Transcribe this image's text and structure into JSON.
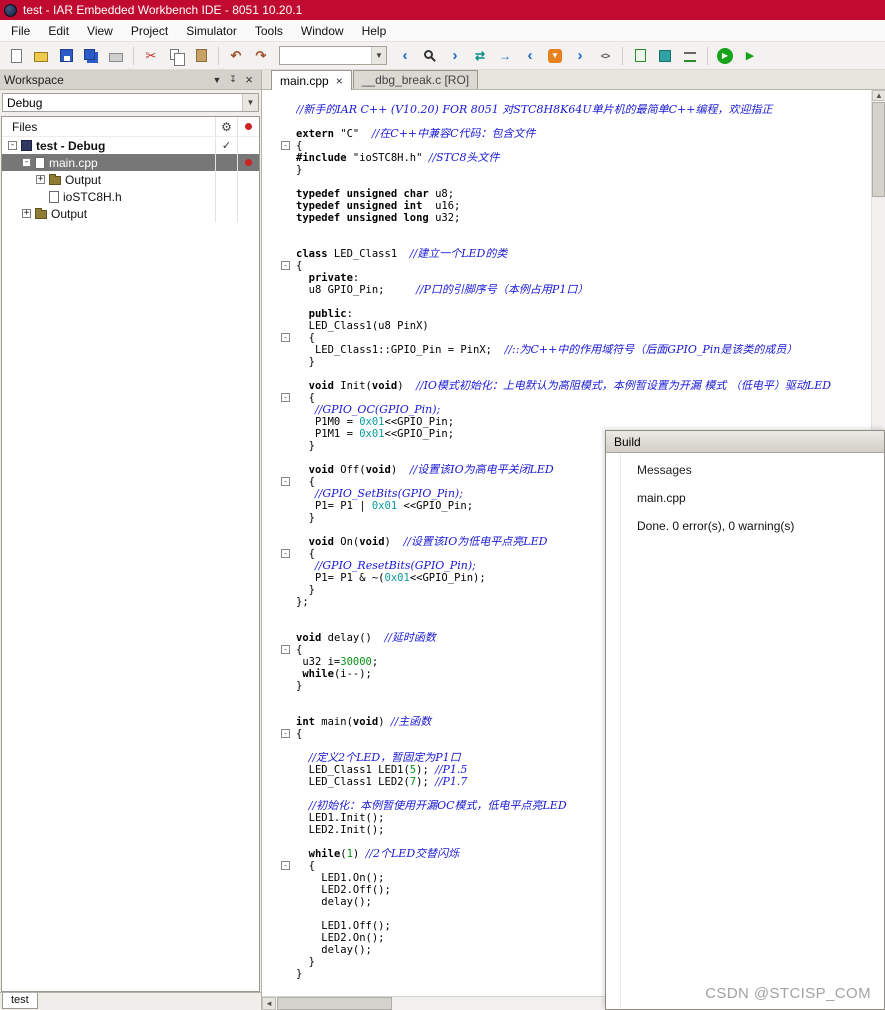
{
  "window": {
    "title": "test - IAR Embedded Workbench IDE - 8051 10.20.1"
  },
  "menu": [
    "File",
    "Edit",
    "View",
    "Project",
    "Simulator",
    "Tools",
    "Window",
    "Help"
  ],
  "toolbar": {
    "find_value": "",
    "buttons": [
      {
        "name": "new-document-icon",
        "kind": "page"
      },
      {
        "name": "open-file-icon",
        "kind": "open"
      },
      {
        "name": "save-icon",
        "kind": "save"
      },
      {
        "name": "save-all-icon",
        "kind": "saveall"
      },
      {
        "name": "print-icon",
        "kind": "print"
      },
      {
        "name": "toolbar-separator",
        "kind": "sep"
      },
      {
        "name": "cut-icon",
        "kind": "cut"
      },
      {
        "name": "copy-icon",
        "kind": "copy"
      },
      {
        "name": "paste-icon",
        "kind": "paste"
      },
      {
        "name": "toolbar-separator",
        "kind": "sep"
      },
      {
        "name": "undo-icon",
        "kind": "undo"
      },
      {
        "name": "redo-icon",
        "kind": "redo"
      },
      {
        "name": "find-combo",
        "kind": "combo"
      },
      {
        "name": "find-previous-icon",
        "kind": "prev"
      },
      {
        "name": "search-icon",
        "kind": "search"
      },
      {
        "name": "find-next-icon",
        "kind": "next"
      },
      {
        "name": "replace-icon",
        "kind": "swap"
      },
      {
        "name": "goto-icon",
        "kind": "goto"
      },
      {
        "name": "nav-back-icon",
        "kind": "prev"
      },
      {
        "name": "download-icon",
        "kind": "shield"
      },
      {
        "name": "nav-forward-icon",
        "kind": "next"
      },
      {
        "name": "toggle-header-source-icon",
        "kind": "hdr"
      },
      {
        "name": "toolbar-separator",
        "kind": "sep"
      },
      {
        "name": "compile-icon",
        "kind": "cdoc"
      },
      {
        "name": "make-icon",
        "kind": "cube"
      },
      {
        "name": "batch-build-icon",
        "kind": "listadd"
      },
      {
        "name": "toolbar-separator",
        "kind": "sep"
      },
      {
        "name": "download-and-debug-icon",
        "kind": "playbig"
      },
      {
        "name": "debug-without-downloading-icon",
        "kind": "play"
      }
    ]
  },
  "workspace": {
    "panel_title": "Workspace",
    "config_selector": "Debug",
    "files_header": "Files",
    "bottom_tab": "test",
    "tree": [
      {
        "label": "test - Debug",
        "level": 0,
        "expand": "-",
        "icon": "project",
        "bold": true,
        "col1": "check",
        "col2": ""
      },
      {
        "label": "main.cpp",
        "level": 1,
        "expand": "-",
        "icon": "file",
        "selected": true,
        "col1": "",
        "col2": "dot"
      },
      {
        "label": "Output",
        "level": 2,
        "expand": "+",
        "icon": "folder",
        "col1": "",
        "col2": ""
      },
      {
        "label": "ioSTC8H.h",
        "level": 2,
        "expand": "",
        "icon": "file",
        "col1": "",
        "col2": ""
      },
      {
        "label": "Output",
        "level": 1,
        "expand": "+",
        "icon": "folder",
        "col1": "",
        "col2": ""
      }
    ]
  },
  "editor": {
    "tabs": [
      {
        "label": "main.cpp",
        "active": true,
        "closable": true
      },
      {
        "label": "__dbg_break.c [RO]",
        "active": false,
        "closable": false
      }
    ],
    "lines": [
      {
        "s": [
          [
            "c",
            "//新手的IAR C++ (V10.20) FOR 8051 对STC8H8K64U单片机的最简单C++编程，欢迎指正"
          ]
        ]
      },
      {
        "s": []
      },
      {
        "s": [
          [
            "k",
            "extern"
          ],
          [
            "p",
            " \"C\"  "
          ],
          [
            "c",
            "//在C++中兼容C代码：包含文件"
          ]
        ]
      },
      {
        "m": 1,
        "s": [
          [
            "p",
            "{"
          ]
        ]
      },
      {
        "s": [
          [
            "k",
            "#include"
          ],
          [
            "p",
            " \"ioSTC8H.h\" "
          ],
          [
            "c",
            "//STC8头文件"
          ]
        ]
      },
      {
        "s": [
          [
            "p",
            "}"
          ]
        ]
      },
      {
        "s": []
      },
      {
        "s": [
          [
            "k",
            "typedef unsigned char"
          ],
          [
            "p",
            " u8;"
          ]
        ]
      },
      {
        "s": [
          [
            "k",
            "typedef unsigned int"
          ],
          [
            "p",
            "  u16;"
          ]
        ]
      },
      {
        "s": [
          [
            "k",
            "typedef unsigned long"
          ],
          [
            "p",
            " u32;"
          ]
        ]
      },
      {
        "s": []
      },
      {
        "s": []
      },
      {
        "s": [
          [
            "k",
            "class"
          ],
          [
            "p",
            " LED_Class1  "
          ],
          [
            "c",
            "//建立一个LED的类"
          ]
        ]
      },
      {
        "m": 1,
        "s": [
          [
            "p",
            "{"
          ]
        ]
      },
      {
        "s": [
          [
            "p",
            "  "
          ],
          [
            "k",
            "private"
          ],
          [
            "p",
            ":"
          ]
        ]
      },
      {
        "s": [
          [
            "p",
            "  u8 GPIO_Pin;     "
          ],
          [
            "c",
            "//P口的引脚序号（本例占用P1口）"
          ]
        ]
      },
      {
        "s": []
      },
      {
        "s": [
          [
            "p",
            "  "
          ],
          [
            "k",
            "public"
          ],
          [
            "p",
            ":"
          ]
        ]
      },
      {
        "s": [
          [
            "p",
            "  LED_Class1(u8 PinX)"
          ]
        ]
      },
      {
        "m": 1,
        "s": [
          [
            "p",
            "  {"
          ]
        ]
      },
      {
        "s": [
          [
            "p",
            "   LED_Class1::GPIO_Pin = PinX;  "
          ],
          [
            "c",
            "//::为C++中的作用域符号（后面GPIO_Pin是该类的成员）"
          ]
        ]
      },
      {
        "s": [
          [
            "p",
            "  }"
          ]
        ]
      },
      {
        "s": []
      },
      {
        "s": [
          [
            "p",
            "  "
          ],
          [
            "k",
            "void"
          ],
          [
            "p",
            " Init("
          ],
          [
            "k",
            "void"
          ],
          [
            "p",
            ")  "
          ],
          [
            "c",
            "//IO模式初始化：上电默认为高阻模式，本例暂设置为开漏 模式 （低电平）驱动LED"
          ]
        ]
      },
      {
        "m": 1,
        "s": [
          [
            "p",
            "  {"
          ]
        ]
      },
      {
        "s": [
          [
            "p",
            "   "
          ],
          [
            "c",
            "//GPIO_OC(GPIO_Pin);"
          ]
        ]
      },
      {
        "s": [
          [
            "p",
            "   P1M0 = "
          ],
          [
            "h",
            "0x01"
          ],
          [
            "p",
            "<<GPIO_Pin;"
          ]
        ]
      },
      {
        "s": [
          [
            "p",
            "   P1M1 = "
          ],
          [
            "h",
            "0x01"
          ],
          [
            "p",
            "<<GPIO_Pin;"
          ]
        ]
      },
      {
        "s": [
          [
            "p",
            "  }"
          ]
        ]
      },
      {
        "s": []
      },
      {
        "s": [
          [
            "p",
            "  "
          ],
          [
            "k",
            "void"
          ],
          [
            "p",
            " Off("
          ],
          [
            "k",
            "void"
          ],
          [
            "p",
            ")  "
          ],
          [
            "c",
            "//设置该IO为高电平关闭LED"
          ]
        ]
      },
      {
        "m": 1,
        "s": [
          [
            "p",
            "  {"
          ]
        ]
      },
      {
        "s": [
          [
            "p",
            "   "
          ],
          [
            "c",
            "//GPIO_SetBits(GPIO_Pin);"
          ]
        ]
      },
      {
        "s": [
          [
            "p",
            "   P1= P1 | "
          ],
          [
            "h",
            "0x01"
          ],
          [
            "p",
            " <<GPIO_Pin;"
          ]
        ]
      },
      {
        "s": [
          [
            "p",
            "  }"
          ]
        ]
      },
      {
        "s": []
      },
      {
        "s": [
          [
            "p",
            "  "
          ],
          [
            "k",
            "void"
          ],
          [
            "p",
            " On("
          ],
          [
            "k",
            "void"
          ],
          [
            "p",
            ")  "
          ],
          [
            "c",
            "//设置该IO为低电平点亮LED"
          ]
        ]
      },
      {
        "m": 1,
        "s": [
          [
            "p",
            "  {"
          ]
        ]
      },
      {
        "s": [
          [
            "p",
            "   "
          ],
          [
            "c",
            "//GPIO_ResetBits(GPIO_Pin);"
          ]
        ]
      },
      {
        "s": [
          [
            "p",
            "   P1= P1 & ~("
          ],
          [
            "h",
            "0x01"
          ],
          [
            "p",
            "<<GPIO_Pin);"
          ]
        ]
      },
      {
        "s": [
          [
            "p",
            "  }"
          ]
        ]
      },
      {
        "s": [
          [
            "p",
            "};"
          ]
        ]
      },
      {
        "s": []
      },
      {
        "s": []
      },
      {
        "s": [
          [
            "k",
            "void"
          ],
          [
            "p",
            " delay()  "
          ],
          [
            "c",
            "//延时函数"
          ]
        ]
      },
      {
        "m": 1,
        "s": [
          [
            "p",
            "{"
          ]
        ]
      },
      {
        "s": [
          [
            "p",
            " u32 i="
          ],
          [
            "n",
            "30000"
          ],
          [
            "p",
            ";"
          ]
        ]
      },
      {
        "s": [
          [
            "p",
            " "
          ],
          [
            "k",
            "while"
          ],
          [
            "p",
            "(i--);"
          ]
        ]
      },
      {
        "s": [
          [
            "p",
            "}"
          ]
        ]
      },
      {
        "s": []
      },
      {
        "s": []
      },
      {
        "s": [
          [
            "k",
            "int"
          ],
          [
            "p",
            " main("
          ],
          [
            "k",
            "void"
          ],
          [
            "p",
            ") "
          ],
          [
            "c",
            "//主函数"
          ]
        ]
      },
      {
        "m": 1,
        "s": [
          [
            "p",
            "{"
          ]
        ]
      },
      {
        "s": []
      },
      {
        "s": [
          [
            "p",
            "  "
          ],
          [
            "c",
            "//定义2个LED，暂固定为P1口"
          ]
        ]
      },
      {
        "s": [
          [
            "p",
            "  LED_Class1 LED1("
          ],
          [
            "n",
            "5"
          ],
          [
            "p",
            "); "
          ],
          [
            "c",
            "//P1.5"
          ]
        ]
      },
      {
        "s": [
          [
            "p",
            "  LED_Class1 LED2("
          ],
          [
            "n",
            "7"
          ],
          [
            "p",
            "); "
          ],
          [
            "c",
            "//P1.7"
          ]
        ]
      },
      {
        "s": []
      },
      {
        "s": [
          [
            "p",
            "  "
          ],
          [
            "c",
            "//初始化：本例暂使用开漏OC模式，低电平点亮LED"
          ]
        ]
      },
      {
        "s": [
          [
            "p",
            "  LED1.Init();"
          ]
        ]
      },
      {
        "s": [
          [
            "p",
            "  LED2.Init();"
          ]
        ]
      },
      {
        "s": []
      },
      {
        "s": [
          [
            "p",
            "  "
          ],
          [
            "k",
            "while"
          ],
          [
            "p",
            "("
          ],
          [
            "n",
            "1"
          ],
          [
            "p",
            ") "
          ],
          [
            "c",
            "//2个LED交替闪烁"
          ]
        ]
      },
      {
        "m": 1,
        "s": [
          [
            "p",
            "  {"
          ]
        ]
      },
      {
        "s": [
          [
            "p",
            "    LED1.On();"
          ]
        ]
      },
      {
        "s": [
          [
            "p",
            "    LED2.Off();"
          ]
        ]
      },
      {
        "s": [
          [
            "p",
            "    delay();"
          ]
        ]
      },
      {
        "s": []
      },
      {
        "s": [
          [
            "p",
            "    LED1.Off();"
          ]
        ]
      },
      {
        "s": [
          [
            "p",
            "    LED2.On();"
          ]
        ]
      },
      {
        "s": [
          [
            "p",
            "    delay();"
          ]
        ]
      },
      {
        "s": [
          [
            "p",
            "  }"
          ]
        ]
      },
      {
        "s": [
          [
            "p",
            "}"
          ]
        ]
      }
    ]
  },
  "build": {
    "title": "Build",
    "column_header": "Messages",
    "messages": [
      "main.cpp",
      "Done. 0 error(s), 0 warning(s)"
    ]
  },
  "watermark": {
    "text": "CSDN @STCISP_COM"
  },
  "colors": {
    "titlebar": "#C00A2F",
    "selection_bg": "#777777",
    "comment": "#1A1AD6",
    "number": "#089414",
    "hex_number": "#0B9A9A",
    "error_dot": "#CC2222",
    "build_titlebar": "#ECEAE5"
  }
}
